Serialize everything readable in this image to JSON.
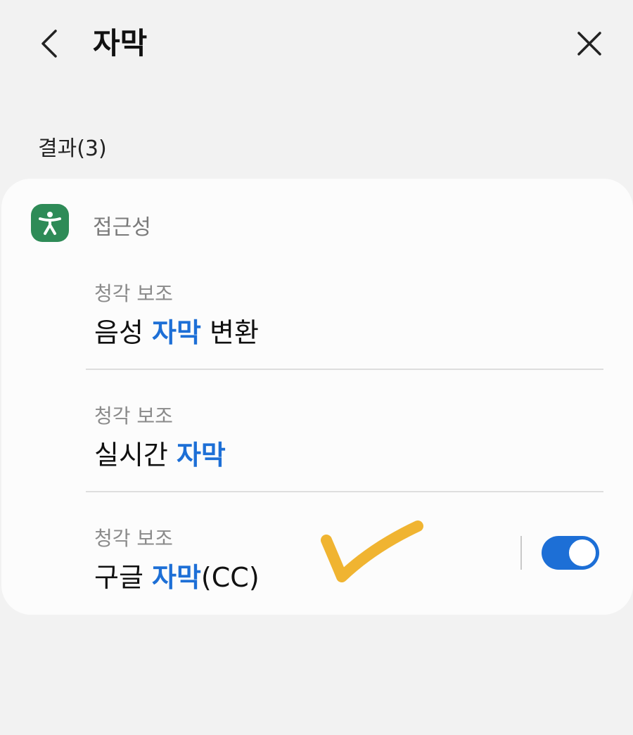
{
  "header": {
    "title": "자막",
    "back_icon": "chevron-left-icon",
    "close_icon": "close-icon"
  },
  "results": {
    "count_label": "결과(3)"
  },
  "category": {
    "label": "접근성",
    "icon": "accessibility-icon",
    "icon_color": "#2e8b57"
  },
  "items": [
    {
      "subtitle": "청각 보조",
      "pre": "음성 ",
      "highlight": "자막",
      "post": " 변환"
    },
    {
      "subtitle": "청각 보조",
      "pre": "실시간 ",
      "highlight": "자막",
      "post": ""
    },
    {
      "subtitle": "청각 보조",
      "pre": "구글 ",
      "highlight": "자막",
      "post": "(CC)",
      "toggle_on": true
    }
  ],
  "colors": {
    "highlight": "#1d6fd6",
    "toggle_on": "#1d6fd6",
    "annotation": "#f0b431",
    "background": "#f2f2f2",
    "card": "#fcfcfc"
  },
  "annotation": {
    "icon": "hand-drawn-checkmark-icon"
  }
}
